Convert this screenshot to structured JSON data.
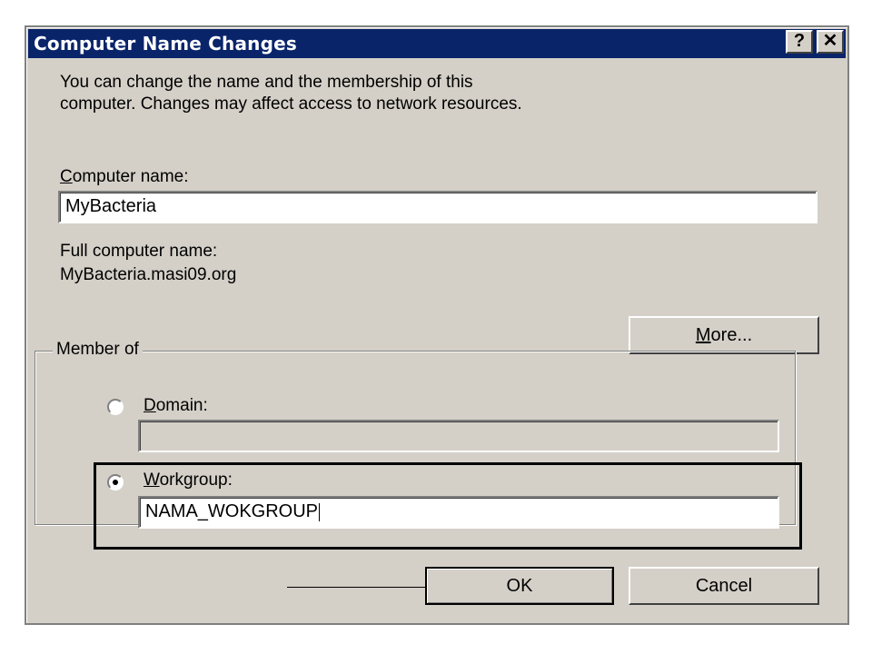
{
  "window": {
    "title": "Computer Name Changes",
    "help_glyph": "?",
    "close_glyph": "✕"
  },
  "intro": {
    "line1": "You can change the name and the membership of this",
    "line2": "computer. Changes may affect access to network resources."
  },
  "computer_name": {
    "label_access": "C",
    "label_rest": "omputer name:",
    "value": "MyBacteria"
  },
  "full_name": {
    "label": "Full computer name:",
    "value": "MyBacteria.masi09.org"
  },
  "more_button": {
    "access": "M",
    "rest": "ore..."
  },
  "member_of": {
    "legend": "Member of",
    "domain": {
      "access": "D",
      "rest": "omain:",
      "value": "",
      "selected": false
    },
    "workgroup": {
      "access": "W",
      "rest": "orkgroup:",
      "value": "NAMA_WOKGROUP",
      "selected": true
    }
  },
  "buttons": {
    "ok": "OK",
    "cancel": "Cancel"
  },
  "colors": {
    "title_bar": "#0a246a",
    "dialog_face": "#d4d0c8"
  }
}
